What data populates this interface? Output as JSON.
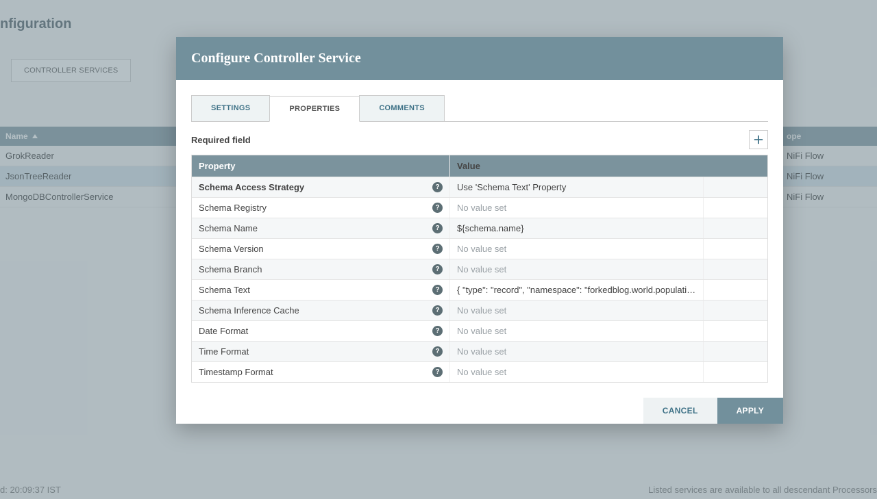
{
  "background": {
    "page_title": "nfiguration",
    "main_tab": "CONTROLLER SERVICES",
    "table": {
      "header_name": "Name",
      "header_scope": "ope",
      "rows": [
        {
          "name": "GrokReader",
          "scope": "NiFi Flow",
          "selected": false
        },
        {
          "name": "JsonTreeReader",
          "scope": "NiFi Flow",
          "selected": true
        },
        {
          "name": "MongoDBControllerService",
          "scope": "NiFi Flow",
          "selected": false
        }
      ]
    },
    "footer_left": "d: 20:09:37 IST",
    "footer_right": "Listed services are available to all descendant Processors"
  },
  "modal": {
    "title": "Configure Controller Service",
    "tabs": {
      "settings": "SETTINGS",
      "properties": "PROPERTIES",
      "comments": "COMMENTS"
    },
    "required_label": "Required field",
    "property_header": "Property",
    "value_header": "Value",
    "properties": [
      {
        "name": "Schema Access Strategy",
        "value": "Use 'Schema Text' Property",
        "novalue": false,
        "bold": true
      },
      {
        "name": "Schema Registry",
        "value": "No value set",
        "novalue": true,
        "bold": false
      },
      {
        "name": "Schema Name",
        "value": "${schema.name}",
        "novalue": false,
        "bold": false
      },
      {
        "name": "Schema Version",
        "value": "No value set",
        "novalue": true,
        "bold": false
      },
      {
        "name": "Schema Branch",
        "value": "No value set",
        "novalue": true,
        "bold": false
      },
      {
        "name": "Schema Text",
        "value": "{ \"type\": \"record\", \"namespace\": \"forkedblog.world.population…",
        "novalue": false,
        "bold": false
      },
      {
        "name": "Schema Inference Cache",
        "value": "No value set",
        "novalue": true,
        "bold": false
      },
      {
        "name": "Date Format",
        "value": "No value set",
        "novalue": true,
        "bold": false
      },
      {
        "name": "Time Format",
        "value": "No value set",
        "novalue": true,
        "bold": false
      },
      {
        "name": "Timestamp Format",
        "value": "No value set",
        "novalue": true,
        "bold": false
      }
    ],
    "cancel": "CANCEL",
    "apply": "APPLY"
  }
}
